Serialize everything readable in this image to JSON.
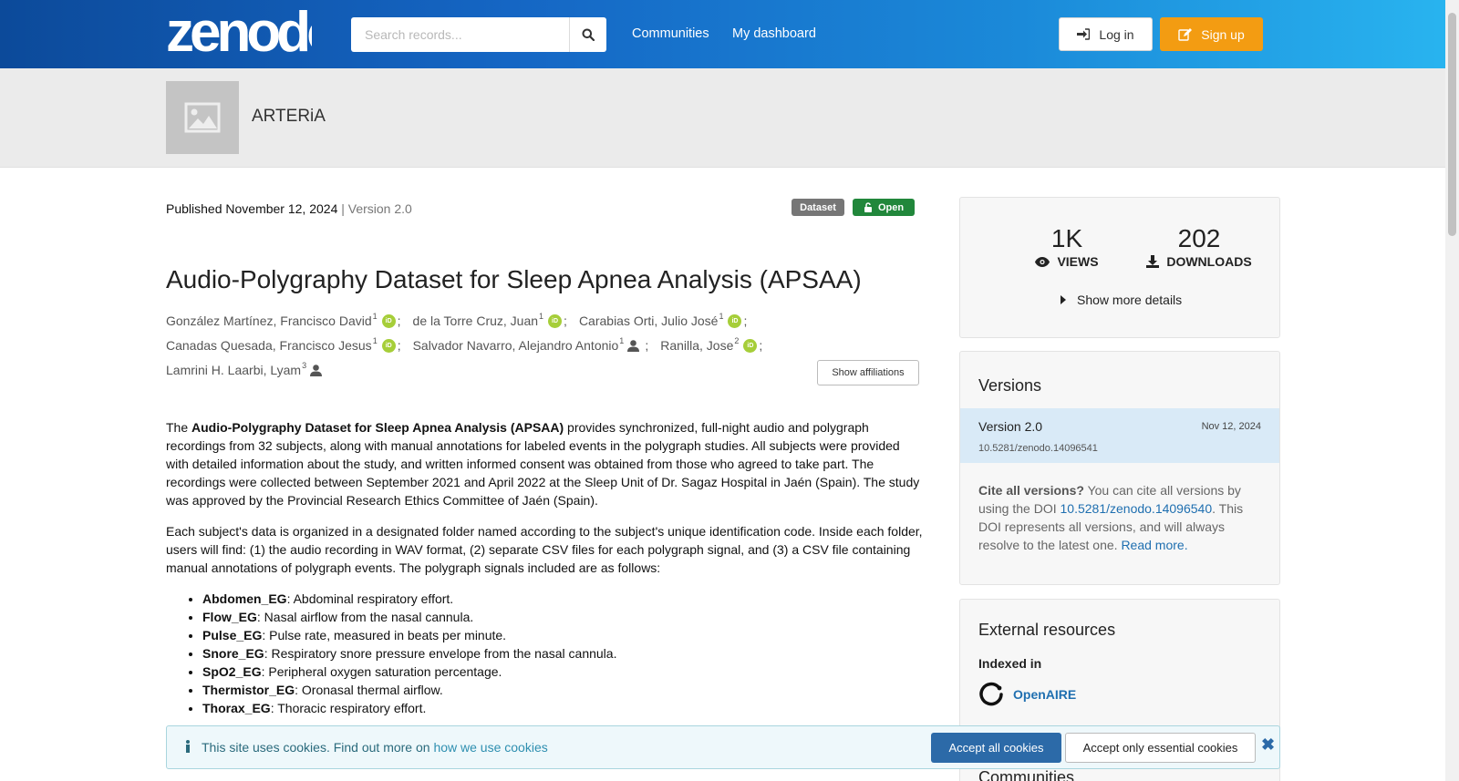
{
  "header": {
    "logo_text": "zenodo",
    "search_placeholder": "Search records...",
    "nav": [
      "Communities",
      "My dashboard"
    ],
    "login_label": "Log in",
    "signup_label": "Sign up"
  },
  "community": {
    "name": "ARTERiA"
  },
  "record": {
    "published_prefix": "Published",
    "published_date": "November 12, 2024",
    "version": "| Version 2.0",
    "badge_type": "Dataset",
    "badge_access": "Open",
    "title": "Audio-Polygraphy Dataset for Sleep Apnea Analysis (APSAA)",
    "authors_lines": [
      [
        {
          "name": "González Martínez, Francisco David",
          "sup": "1",
          "icon": "orcid-icon"
        },
        {
          "name": "de la Torre Cruz, Juan",
          "sup": "1",
          "icon": "orcid-icon"
        },
        {
          "name": "Carabias Orti, Julio José",
          "sup": "1",
          "icon": "orcid-icon"
        }
      ],
      [
        {
          "name": "Canadas Quesada, Francisco Jesus",
          "sup": "1",
          "icon": "orcid-icon"
        },
        {
          "name": "Salvador Navarro, Alejandro Antonio",
          "sup": "1",
          "icon": "person-icon"
        },
        {
          "name": "Ranilla, Jose",
          "sup": "2",
          "icon": "orcid-icon"
        }
      ],
      [
        {
          "name": "Lamrini H. Laarbi, Lyam",
          "sup": "3",
          "icon": "person-icon"
        }
      ]
    ],
    "orcid_text": "iD",
    "show_affiliations": "Show affiliations",
    "description": {
      "p1_pre": "The ",
      "p1_bold": "Audio-Polygraphy Dataset for Sleep Apnea Analysis (APSAA)",
      "p1_post": " provides synchronized, full-night audio and polygraph recordings from 32 subjects, along with manual annotations for labeled events in the polygraph studies.  All subjects were provided with detailed information about the study, and written informed consent was obtained from those who agreed to take part. The recordings were collected between September 2021 and April 2022 at the Sleep Unit of Dr. Sagaz Hospital in Jaén (Spain). The study was approved by the Provincial Research Ethics Committee of Jaén (Spain).",
      "p2": "Each subject's data is organized in a designated folder named according to the subject's unique identification code. Inside each folder, users will find: (1) the audio recording in WAV format, (2) separate CSV files for each polygraph signal, and (3) a CSV file containing manual annotations of polygraph events. The polygraph signals included are as follows:",
      "signals": [
        {
          "name": "Abdomen_EG",
          "desc": ": Abdominal respiratory effort."
        },
        {
          "name": "Flow_EG",
          "desc": ": Nasal airflow from the nasal cannula."
        },
        {
          "name": "Pulse_EG",
          "desc": ": Pulse rate, measured in beats per minute."
        },
        {
          "name": "Snore_EG",
          "desc": ": Respiratory snore pressure envelope from the nasal cannula."
        },
        {
          "name": "SpO2_EG",
          "desc": ": Peripheral oxygen saturation percentage."
        },
        {
          "name": "Thermistor_EG",
          "desc": ": Oronasal thermal airflow."
        },
        {
          "name": "Thorax_EG",
          "desc": ": Thoracic respiratory effort."
        }
      ]
    }
  },
  "stats": {
    "views_value": "1K",
    "views_label": "VIEWS",
    "downloads_value": "202",
    "downloads_label": "DOWNLOADS",
    "more_details": "Show more details"
  },
  "versions": {
    "title": "Versions",
    "current_name": "Version 2.0",
    "current_date": "Nov 12, 2024",
    "current_doi": "10.5281/zenodo.14096541",
    "cite_bold": "Cite all versions?",
    "cite_text_1": " You can cite all versions by using the DOI ",
    "cite_doi": "10.5281/zenodo.14096540",
    "cite_text_2": ". This DOI represents all versions, and will always resolve to the latest one. ",
    "read_more": "Read more."
  },
  "external": {
    "title": "External resources",
    "indexed_in": "Indexed in",
    "openaire": "OpenAIRE",
    "communities_title": "Communities"
  },
  "cookie": {
    "message": "This site uses cookies. Find out more on ",
    "link": "how we use cookies",
    "accept_all": "Accept all cookies",
    "accept_essential": "Accept only essential cookies",
    "close": "✖"
  },
  "colors": {
    "header_start": "#0c4a9a",
    "header_end": "#29b5f0",
    "signup": "#f39c12",
    "open_badge": "#21873b",
    "link": "#1f6fb0",
    "orcid": "#a6ce39"
  }
}
